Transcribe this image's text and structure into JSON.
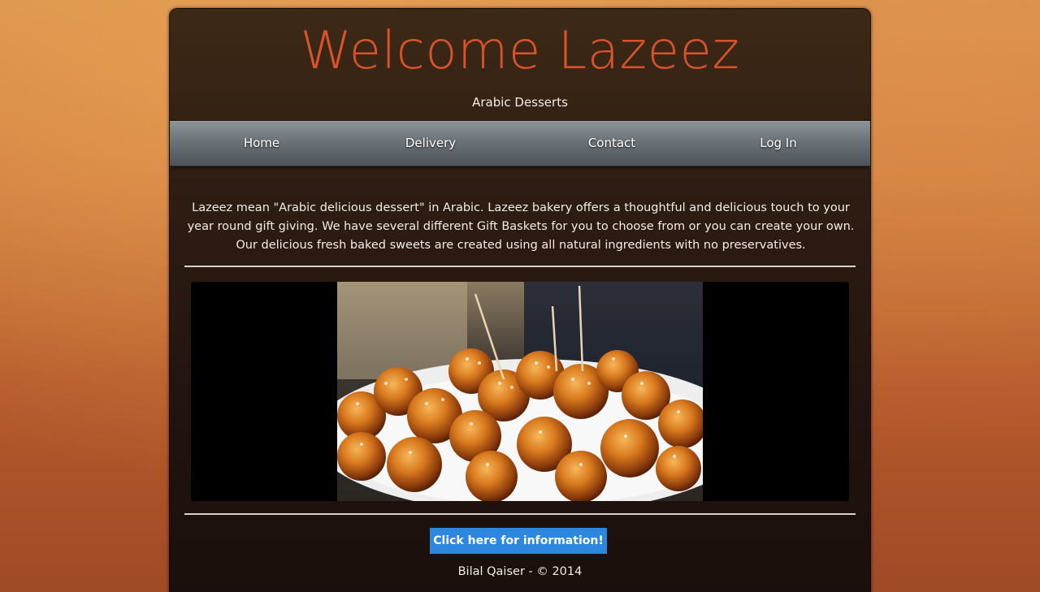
{
  "header": {
    "title": "Welcome Lazeez",
    "tagline": "Arabic Desserts"
  },
  "nav": {
    "items": [
      {
        "label": "Home"
      },
      {
        "label": "Delivery"
      },
      {
        "label": "Contact"
      },
      {
        "label": "Log In"
      }
    ]
  },
  "main": {
    "intro": "Lazeez mean \"Arabic delicious dessert\" in Arabic. Lazeez bakery offers a thoughtful and delicious touch to your year round gift giving. We have several different Gift Baskets for you to choose from or you can create your own. Our delicious fresh baked sweets are created using all natural ingredients with no preservatives.",
    "info_button_label": "Click here for information!"
  },
  "footer": {
    "text": "Bilal Qaiser - © 2014"
  },
  "colors": {
    "title": "#d8532c",
    "button": "#2d87df"
  }
}
